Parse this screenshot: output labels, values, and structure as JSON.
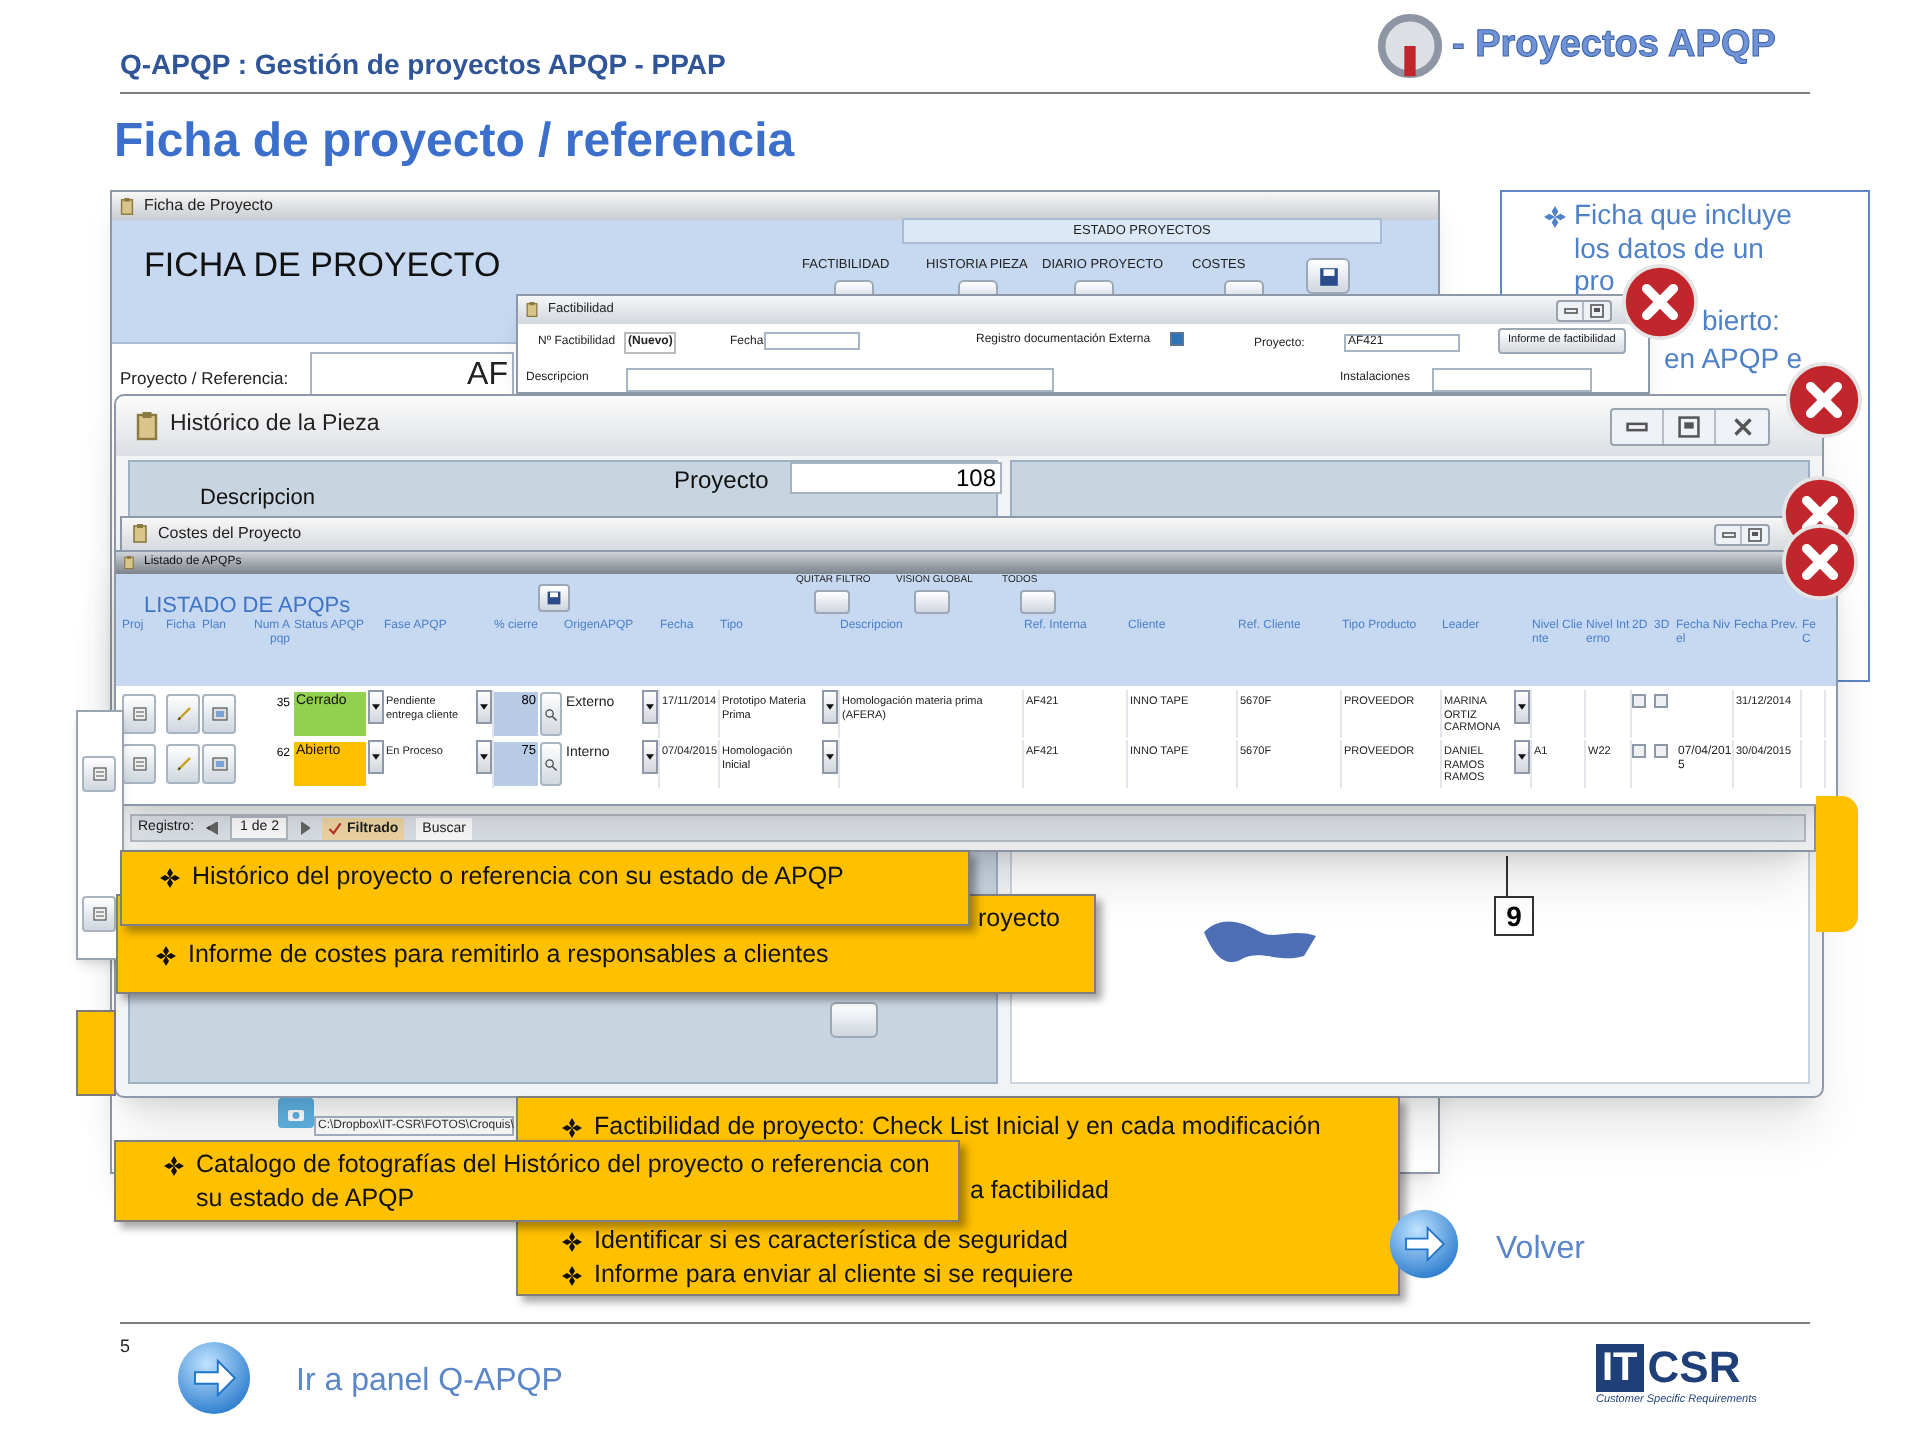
{
  "header": {
    "title": "Q-APQP : Gestión de proyectos APQP - PPAP",
    "logo_text": "- Proyectos APQP"
  },
  "heading": "Ficha de proyecto / referencia",
  "note": {
    "lines": [
      "Ficha que incluye",
      "los datos de un",
      "pro",
      "bierto:",
      "en APQP e"
    ]
  },
  "ficha": {
    "title": "Ficha de Proyecto",
    "heading": "FICHA DE PROYECTO",
    "estado_label": "ESTADO PROYECTOS",
    "status_buttons": [
      "FACTIBILIDAD",
      "HISTORIA PIEZA",
      "DIARIO PROYECTO",
      "COSTES"
    ],
    "field_label": "Proyecto / Referencia:",
    "field_value": "AF",
    "photo_path": "C:\\Dropbox\\IT-CSR\\FOTOS\\Croquis\\"
  },
  "factibilidad": {
    "title": "Factibilidad",
    "numero_label": "Nº Factibilidad",
    "numero_value": "(Nuevo)",
    "fecha_label": "Fecha",
    "registro_label": "Registro documentación Externa",
    "registro_checked": true,
    "proyecto_label": "Proyecto:",
    "proyecto_value": "AF421",
    "button": "Informe de factibilidad",
    "descripcion_label": "Descripcion",
    "instalaciones_label": "Instalaciones"
  },
  "historico": {
    "title": "Histórico de la Pieza",
    "proyecto_label": "Proyecto",
    "proyecto_value": "108",
    "descripcion_label": "Descripcion",
    "diagram_label": "9"
  },
  "costes": {
    "title": "Costes del Proyecto",
    "nav": {
      "registro_label": "Registro:",
      "position": "1 de 2",
      "filter": "Filtrado",
      "search": "Buscar"
    }
  },
  "listado": {
    "title": "Listado de APQPs",
    "heading": "LISTADO DE APQPs",
    "toolbar": [
      "QUITAR FILTRO",
      "VISION GLOBAL",
      "TODOS"
    ],
    "columns": [
      "Proj",
      "Ficha",
      "Plan",
      "Num Apqp",
      "Status APQP",
      "Fase APQP",
      "% cierre",
      "OrigenAPQP",
      "Fecha",
      "Tipo",
      "Descripcion",
      "Ref. Interna",
      "Cliente",
      "Ref. Cliente",
      "Tipo Producto",
      "Leader",
      "Nivel Cliente",
      "Nivel Interno",
      "2D",
      "3D",
      "Fecha Nivel",
      "Fecha Prev.",
      "Fe C"
    ],
    "rows": [
      {
        "num": "35",
        "status": {
          "text": "Cerrado",
          "color": "#92d050"
        },
        "fase": "Pendiente entrega cliente",
        "cierre": "80",
        "origen": "Externo",
        "fecha": "17/11/2014",
        "tipo": "Prototipo Materia Prima",
        "descripcion": "Homologación materia prima (AFERA)",
        "ref_interna": "AF421",
        "cliente": "INNO TAPE",
        "ref_cliente": "5670F",
        "tipo_producto": "PROVEEDOR",
        "leader": "MARINA ORTIZ CARMONA",
        "check_2d": false,
        "check_3d": false,
        "fecha_prev": "31/12/2014"
      },
      {
        "num": "62",
        "status": {
          "text": "Abierto",
          "color": "#ffc000"
        },
        "fase": "En Proceso",
        "cierre": "75",
        "origen": "Interno",
        "fecha": "07/04/2015",
        "tipo": "Homologación Inicial",
        "ref_interna": "AF421",
        "cliente": "INNO TAPE",
        "ref_cliente": "5670F",
        "tipo_producto": "PROVEEDOR",
        "leader": "DANIEL RAMOS RAMOS",
        "nivel_cliente": "A1",
        "nivel_interno": "W22",
        "check_2d": false,
        "check_3d": false,
        "fecha_nivel": "07/04/2015",
        "fecha_prev": "30/04/2015"
      }
    ]
  },
  "callouts": [
    {
      "lines": [
        "Histórico del proyecto o referencia con su estado de APQP"
      ]
    },
    {
      "lines": [
        "royecto",
        "Informe de costes para remitirlo a responsables a clientes"
      ]
    },
    {
      "lines": [
        "Factibilidad de proyecto: Check List Inicial y en cada modificación",
        "a factibilidad",
        "Identificar si es característica de seguridad",
        "Informe para enviar al cliente si se requiere"
      ]
    },
    {
      "lines": [
        "Catalogo de fotografías del Histórico del proyecto o referencia con su estado de APQP"
      ]
    }
  ],
  "footer": {
    "back": "Volver",
    "page": "5",
    "panel_link": "Ir a panel Q-APQP",
    "logo_main": "CSR",
    "logo_prefix": "IT",
    "logo_sub": "Customer Specific Requirements"
  }
}
